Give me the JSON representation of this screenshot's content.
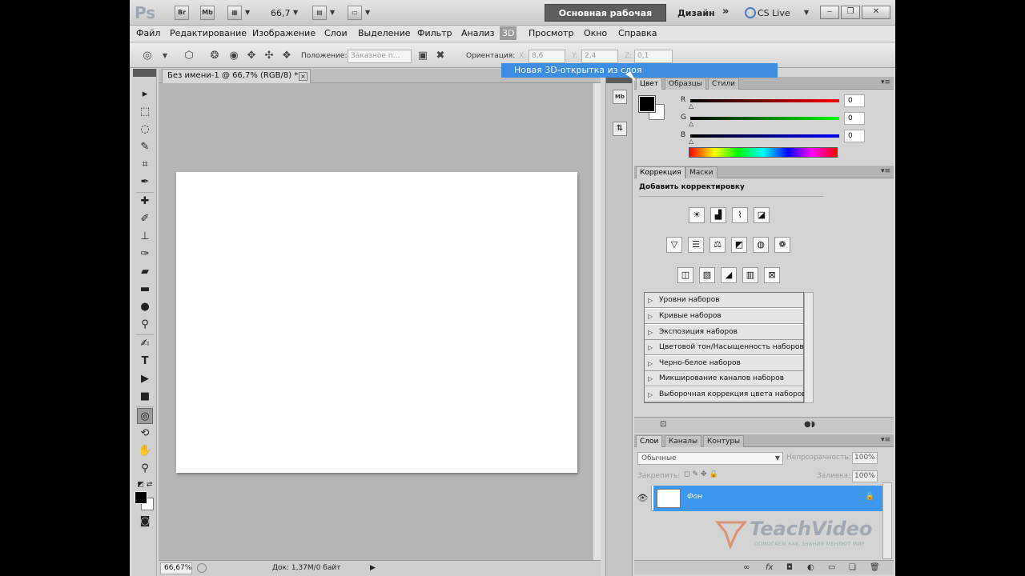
{
  "appbar": {
    "logo": "Ps",
    "bridge_label": "Br",
    "minibridge_label": "Mb",
    "zoom_value": "66,7",
    "workspace_button": "Основная рабочая среда",
    "workspace_design": "Дизайн",
    "workspace_more": "»",
    "cslive_label": "CS Live",
    "win_min": "‒",
    "win_max": "❐",
    "win_close": "✕"
  },
  "menu": {
    "items": [
      "Файл",
      "Редактирование",
      "Изображение",
      "Слои",
      "Выделение",
      "Фильтр",
      "Анализ",
      "3D",
      "Просмотр",
      "Окно",
      "Справка"
    ],
    "active": "3D",
    "popup_item": "Новая 3D-открытка из слоя"
  },
  "options": {
    "position_label": "Положение:",
    "position_value": "Заказное п...",
    "orientation_label": "Ориентация:",
    "x_label": "X:",
    "x_value": "8,6",
    "y_label": "Y:",
    "y_value": "2,4",
    "z_label": "Z:",
    "z_value": "0,1"
  },
  "document": {
    "tab_title": "Без имени-1 @ 66,7% (RGB/8) *",
    "tab_close": "×",
    "zoom_status": "66,67%",
    "doc_info": "Док: 1,37M/0 байт",
    "status_arrow": "▶"
  },
  "dock": {
    "minibridge": "Mb"
  },
  "color_panel": {
    "tabs": [
      "Цвет",
      "Образцы",
      "Стили"
    ],
    "r_label": "R",
    "g_label": "G",
    "b_label": "B",
    "r_value": "0",
    "g_value": "0",
    "b_value": "0"
  },
  "adjustments_panel": {
    "tabs": [
      "Коррекция",
      "Маски"
    ],
    "title": "Добавить корректировку",
    "presets": [
      "Уровни наборов",
      "Кривые наборов",
      "Экспозиция наборов",
      "Цветовой тон/Насыщенность наборов",
      "Черно-белое наборов",
      "Микширование каналов наборов",
      "Выборочная коррекция цвета наборов"
    ]
  },
  "layers_panel": {
    "tabs": [
      "Слои",
      "Каналы",
      "Контуры"
    ],
    "blend_mode": "Обычные",
    "opacity_label": "Непрозрачность:",
    "opacity_value": "100%",
    "lock_label": "Закрепить:",
    "fill_label": "Заливка:",
    "fill_value": "100%",
    "layer_name": "Фон",
    "watermark": "TeachVideo",
    "watermark_tag": "ПОМОГАЕМ КАК ЗНАНИЯ МЕНЯЮТ МИР"
  },
  "colors": {
    "accent_blue": "#3d98ee",
    "workspace_dark": "#5d5d5d",
    "canvas_bg": "#b5b5b5"
  }
}
